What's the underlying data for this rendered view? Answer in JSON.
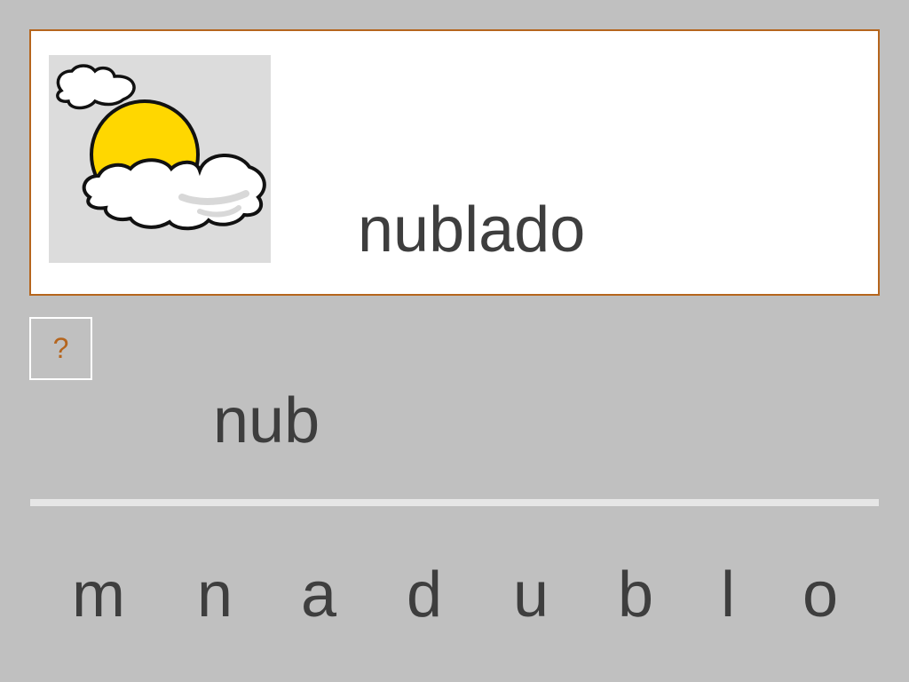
{
  "card": {
    "word": "nublado",
    "image_icon": "sun-behind-clouds-icon",
    "border_color": "#b5651d"
  },
  "hint_button": {
    "label": "?",
    "color": "#b5651d"
  },
  "answer": {
    "typed": "nub"
  },
  "letters": [
    "m",
    "n",
    "a",
    "d",
    "u",
    "b",
    "l",
    "o"
  ],
  "colors": {
    "background": "#c0c0c0",
    "text": "#3e3e3e",
    "sun": "#ffd700",
    "image_bg": "#dcdcdc"
  }
}
